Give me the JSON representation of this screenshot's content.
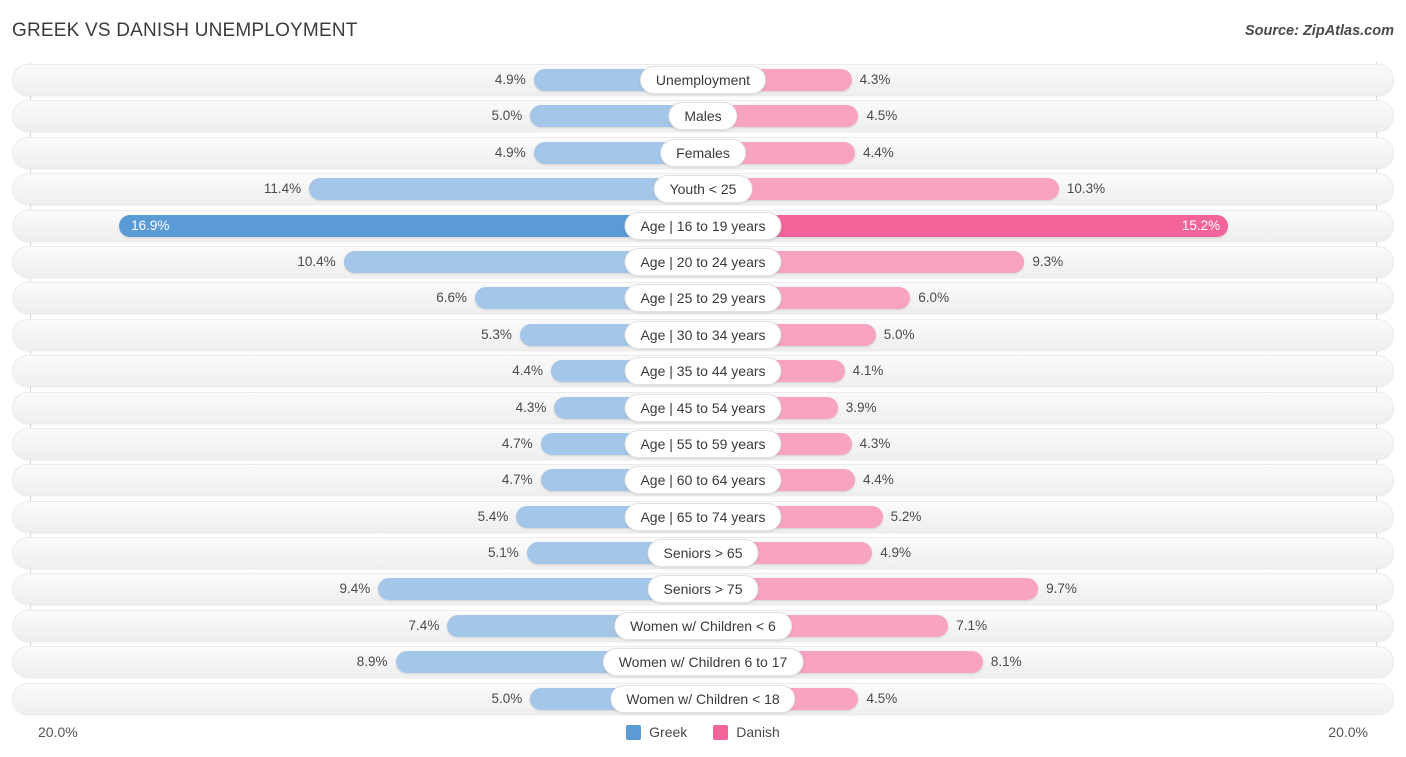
{
  "header": {
    "title": "GREEK VS DANISH UNEMPLOYMENT",
    "source": "Source: ZipAtlas.com"
  },
  "axis": {
    "left_label": "20.0%",
    "right_label": "20.0%",
    "max": 20.0
  },
  "legend": {
    "items": [
      {
        "label": "Greek",
        "color": "#5b9bd5"
      },
      {
        "label": "Danish",
        "color": "#f2649a"
      }
    ]
  },
  "colors": {
    "left_normal": "#a4c6e8",
    "left_highlight": "#5b9bd5",
    "right_normal": "#f8a3c1",
    "right_highlight": "#f2649a",
    "right_strong": "#f4traverse"
  },
  "chart_data": {
    "type": "bar",
    "title": "GREEK VS DANISH UNEMPLOYMENT",
    "subtitle": "Source: ZipAtlas.com",
    "orientation": "horizontal-diverging",
    "xlabel": "",
    "ylabel": "",
    "xlim": [
      20.0,
      20.0
    ],
    "grid": false,
    "legend_position": "bottom-center",
    "series": [
      {
        "name": "Greek",
        "color": "#5b9bd5",
        "side": "left",
        "values": [
          4.9,
          5.0,
          4.9,
          11.4,
          16.9,
          10.4,
          6.6,
          5.3,
          4.4,
          4.3,
          4.7,
          4.7,
          5.4,
          5.1,
          9.4,
          7.4,
          8.9,
          5.0
        ]
      },
      {
        "name": "Danish",
        "color": "#f2649a",
        "side": "right",
        "values": [
          4.3,
          4.5,
          4.4,
          10.3,
          15.2,
          9.3,
          6.0,
          5.0,
          4.1,
          3.9,
          4.3,
          4.4,
          5.2,
          4.9,
          9.7,
          7.1,
          8.1,
          4.5
        ]
      }
    ],
    "categories": [
      "Unemployment",
      "Males",
      "Females",
      "Youth < 25",
      "Age | 16 to 19 years",
      "Age | 20 to 24 years",
      "Age | 25 to 29 years",
      "Age | 30 to 34 years",
      "Age | 35 to 44 years",
      "Age | 45 to 54 years",
      "Age | 55 to 59 years",
      "Age | 60 to 64 years",
      "Age | 65 to 74 years",
      "Seniors > 65",
      "Seniors > 75",
      "Women w/ Children < 6",
      "Women w/ Children 6 to 17",
      "Women w/ Children < 18"
    ]
  },
  "rows": [
    {
      "category": "Unemployment",
      "left_value": 4.9,
      "right_value": 4.3,
      "left_label": "4.9%",
      "right_label": "4.3%",
      "highlight": false
    },
    {
      "category": "Males",
      "left_value": 5.0,
      "right_value": 4.5,
      "left_label": "5.0%",
      "right_label": "4.5%",
      "highlight": false
    },
    {
      "category": "Females",
      "left_value": 4.9,
      "right_value": 4.4,
      "left_label": "4.9%",
      "right_label": "4.4%",
      "highlight": false
    },
    {
      "category": "Youth < 25",
      "left_value": 11.4,
      "right_value": 10.3,
      "left_label": "11.4%",
      "right_label": "10.3%",
      "highlight": false
    },
    {
      "category": "Age | 16 to 19 years",
      "left_value": 16.9,
      "right_value": 15.2,
      "left_label": "16.9%",
      "right_label": "15.2%",
      "highlight": true
    },
    {
      "category": "Age | 20 to 24 years",
      "left_value": 10.4,
      "right_value": 9.3,
      "left_label": "10.4%",
      "right_label": "9.3%",
      "highlight": false
    },
    {
      "category": "Age | 25 to 29 years",
      "left_value": 6.6,
      "right_value": 6.0,
      "left_label": "6.6%",
      "right_label": "6.0%",
      "highlight": false
    },
    {
      "category": "Age | 30 to 34 years",
      "left_value": 5.3,
      "right_value": 5.0,
      "left_label": "5.3%",
      "right_label": "5.0%",
      "highlight": false
    },
    {
      "category": "Age | 35 to 44 years",
      "left_value": 4.4,
      "right_value": 4.1,
      "left_label": "4.4%",
      "right_label": "4.1%",
      "highlight": false
    },
    {
      "category": "Age | 45 to 54 years",
      "left_value": 4.3,
      "right_value": 3.9,
      "left_label": "4.3%",
      "right_label": "3.9%",
      "highlight": false
    },
    {
      "category": "Age | 55 to 59 years",
      "left_value": 4.7,
      "right_value": 4.3,
      "left_label": "4.7%",
      "right_label": "4.3%",
      "highlight": false
    },
    {
      "category": "Age | 60 to 64 years",
      "left_value": 4.7,
      "right_value": 4.4,
      "left_label": "4.7%",
      "right_label": "4.4%",
      "highlight": false
    },
    {
      "category": "Age | 65 to 74 years",
      "left_value": 5.4,
      "right_value": 5.2,
      "left_label": "5.4%",
      "right_label": "5.2%",
      "highlight": false
    },
    {
      "category": "Seniors > 65",
      "left_value": 5.1,
      "right_value": 4.9,
      "left_label": "5.1%",
      "right_label": "4.9%",
      "highlight": false
    },
    {
      "category": "Seniors > 75",
      "left_value": 9.4,
      "right_value": 9.7,
      "left_label": "9.4%",
      "right_label": "9.7%",
      "highlight": false
    },
    {
      "category": "Women w/ Children < 6",
      "left_value": 7.4,
      "right_value": 7.1,
      "left_label": "7.4%",
      "right_label": "7.1%",
      "highlight": false
    },
    {
      "category": "Women w/ Children 6 to 17",
      "left_value": 8.9,
      "right_value": 8.1,
      "left_label": "8.9%",
      "right_label": "8.1%",
      "highlight": false
    },
    {
      "category": "Women w/ Children < 18",
      "left_value": 5.0,
      "right_value": 4.5,
      "left_label": "5.0%",
      "right_label": "4.5%",
      "highlight": false
    }
  ]
}
